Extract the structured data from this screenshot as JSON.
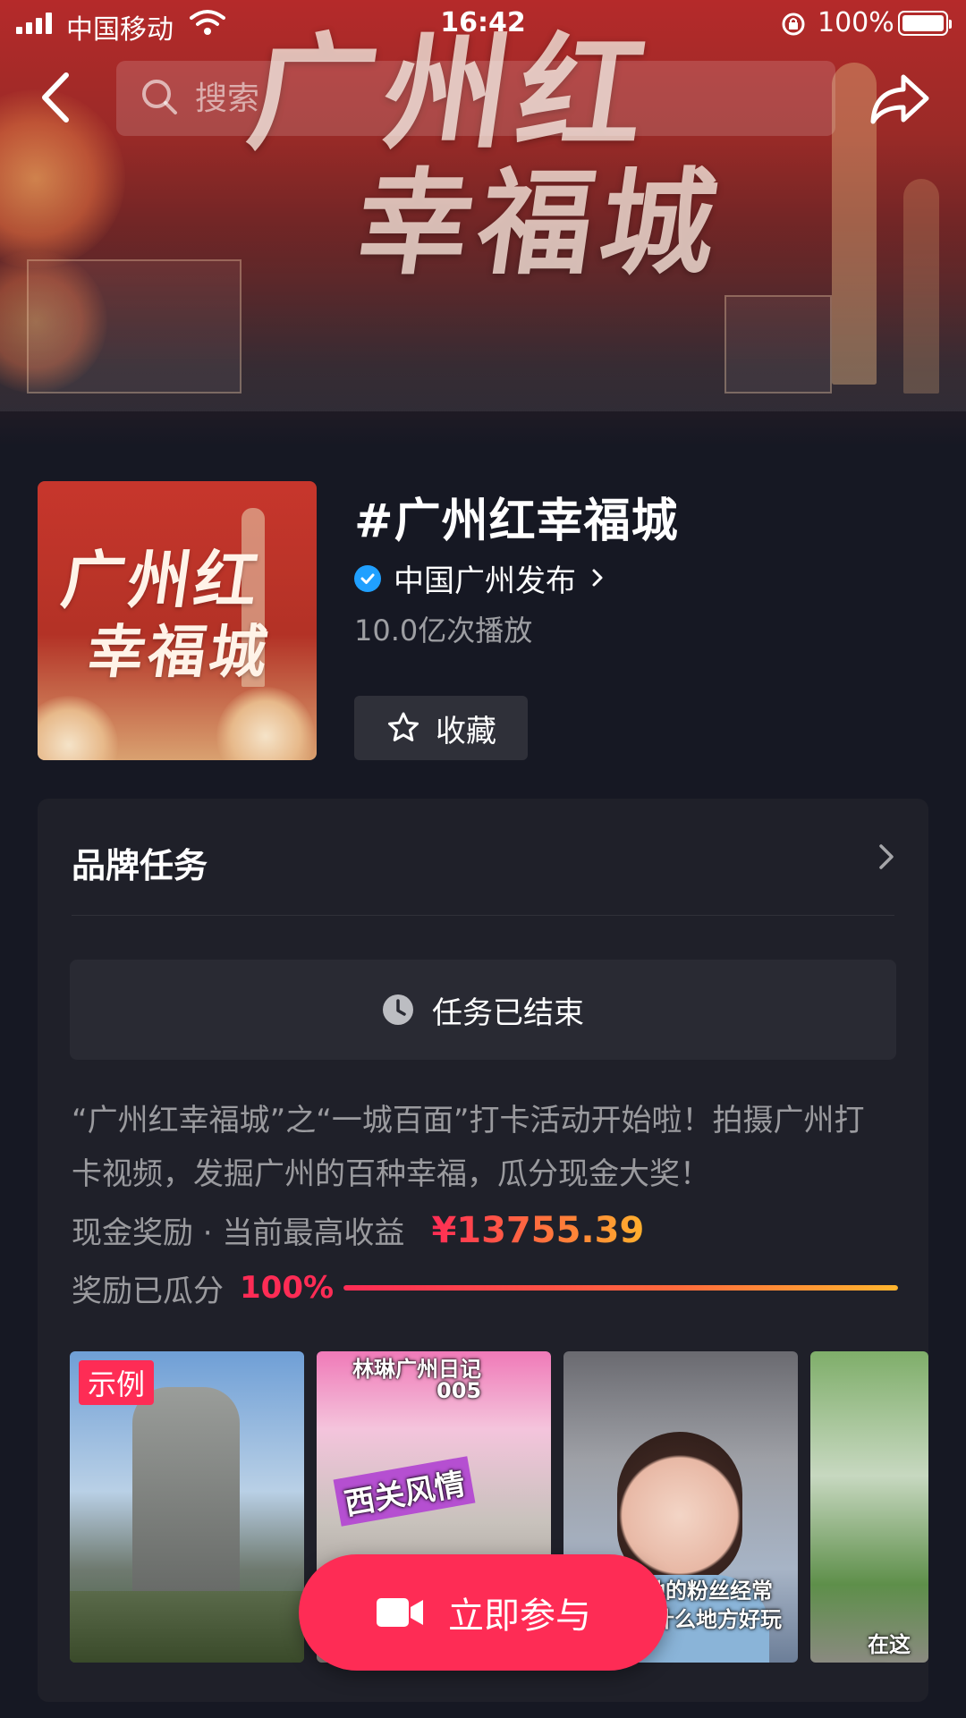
{
  "status_bar": {
    "carrier": "中国移动",
    "time": "16:42",
    "battery_pct": "100%",
    "battery_level": 1.0
  },
  "nav": {
    "search_placeholder": "搜索",
    "back_icon": "chevron-left-icon",
    "share_icon": "share-arrow-icon"
  },
  "banner": {
    "art_title_line1": "广州红",
    "art_title_line2": "幸福城"
  },
  "topic": {
    "cover_line1": "广州红",
    "cover_line2": "幸福城",
    "title": "#广州红幸福城",
    "author": "中国广州发布",
    "author_verified": true,
    "plays": "10.0亿次播放",
    "favorite_label": "收藏"
  },
  "brand_task": {
    "heading": "品牌任务",
    "status": "任务已结束",
    "description": "“广州红幸福城”之“一城百面”打卡活动开始啦！拍摄广州打卡视频，发掘广州的百种幸福，瓜分现金大奖！",
    "reward_label": "现金奖励 · 当前最高收益",
    "reward_amount": "¥13755.39",
    "progress_label": "奖励已瓜分",
    "progress_value": "100%",
    "progress_fraction": 1.0,
    "example_tag": "示例",
    "thumbs": [
      {
        "caption": ""
      },
      {
        "caption_top": "林琳广州日记",
        "caption_num": "005",
        "caption_tag": "西关风情"
      },
      {
        "caption": "她的粉丝经常",
        "caption2": "什么地方好玩"
      },
      {
        "caption": "在这里"
      }
    ]
  },
  "action": {
    "join_label": "立即参与"
  },
  "colors": {
    "background": "#161823",
    "card": "#1f2029",
    "accent": "#fe2c55",
    "verified": "#20a0ff"
  }
}
